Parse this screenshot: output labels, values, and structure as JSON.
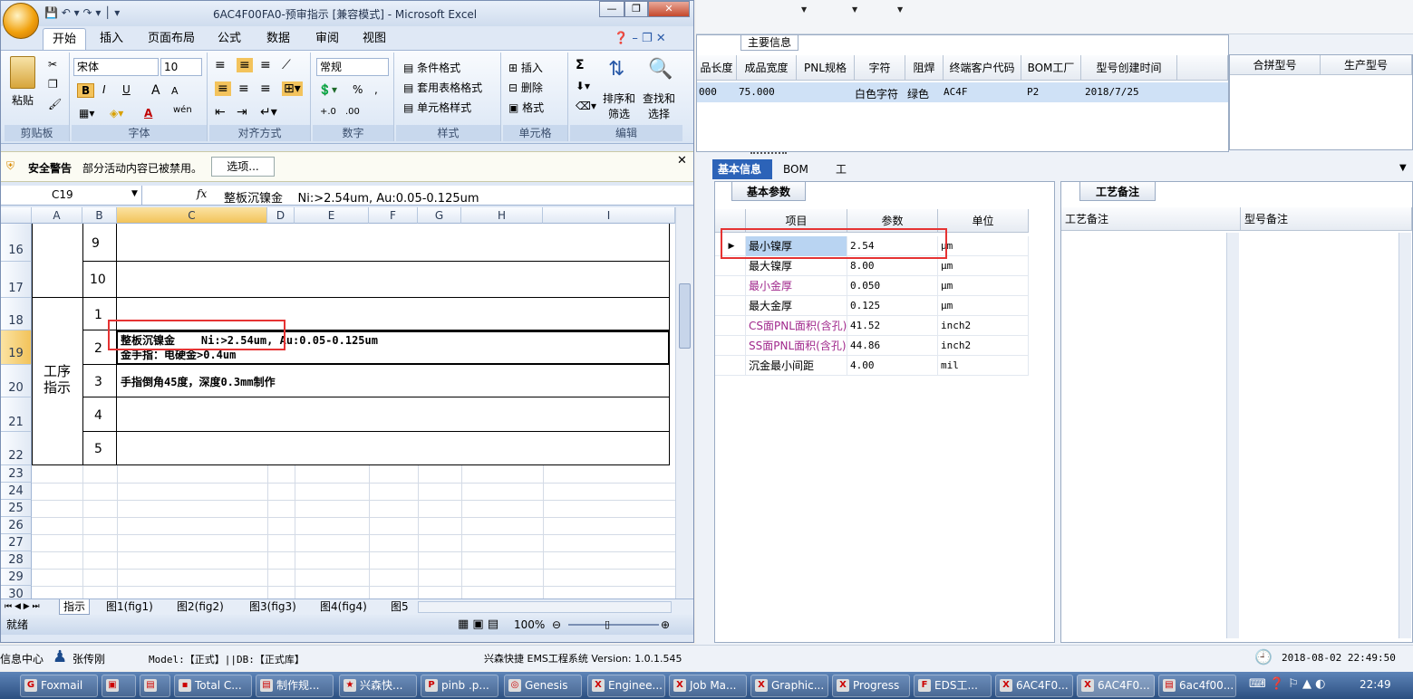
{
  "excel": {
    "title": "6AC4F00FA0-预审指示 [兼容模式] - Microsoft Excel",
    "tabs": [
      "开始",
      "插入",
      "页面布局",
      "公式",
      "数据",
      "审阅",
      "视图"
    ],
    "clipboard": {
      "paste": "粘贴",
      "label": "剪贴板"
    },
    "font": {
      "name": "宋体",
      "size": "10",
      "label": "字体",
      "bold": "B",
      "italic": "I",
      "underline": "U",
      "grow": "A",
      "shrink": "A",
      "fontcolor": "A",
      "phonetic": "wén"
    },
    "alignment": {
      "label": "对齐方式"
    },
    "number": {
      "format": "常规",
      "label": "数字",
      "percent": "%",
      "comma": ",",
      "inc": "+.0",
      "dec": ".00"
    },
    "styles": {
      "cond": "条件格式",
      "table": "套用表格格式",
      "cell": "单元格样式",
      "label": "样式"
    },
    "cells": {
      "insert": "插入",
      "delete": "删除",
      "format": "格式",
      "label": "单元格"
    },
    "editing": {
      "sum": "Σ",
      "sort": "排序和\n筛选",
      "find": "查找和\n选择",
      "label": "编辑"
    },
    "security": {
      "title": "安全警告",
      "msg": "部分活动内容已被禁用。",
      "options": "选项..."
    },
    "namebox": "C19",
    "fx": "fx",
    "formula": "整板沉镍金    Ni:>2.54um, Au:0.05-0.125um",
    "columns": [
      "A",
      "B",
      "C",
      "D",
      "E",
      "F",
      "G",
      "H",
      "I"
    ],
    "rows": [
      {
        "num": "16",
        "b": "9",
        "c": ""
      },
      {
        "num": "17",
        "b": "10",
        "c": ""
      },
      {
        "num": "18",
        "b": "1",
        "c": ""
      },
      {
        "num": "19",
        "b": "2",
        "c": "整板沉镍金    Ni:>2.54um, Au:0.05-0.125um",
        "c2": "金手指：电硬金>0.4um"
      },
      {
        "num": "20",
        "b": "3",
        "c": "手指倒角45度，深度0.3mm制作"
      },
      {
        "num": "21",
        "b": "4",
        "c": ""
      },
      {
        "num": "22",
        "b": "5",
        "c": ""
      }
    ],
    "merged_a": "工序\n指示",
    "empty_rows": [
      "23",
      "24",
      "25",
      "26",
      "27",
      "28",
      "29",
      "30"
    ],
    "sheet_tabs": [
      "指示",
      "图1(fig1)",
      "图2(fig2)",
      "图3(fig3)",
      "图4(fig4)",
      "图5"
    ],
    "status": "就绪",
    "zoom": "100%"
  },
  "ems": {
    "main_info_title": "主要信息",
    "headers": [
      "品长度",
      "成品宽度",
      "PNL规格",
      "字符",
      "阻焊",
      "终端客户代码",
      "BOM工厂",
      "型号创建时间"
    ],
    "row": [
      "000",
      "75.000",
      "",
      "白色字符",
      "绿色",
      "AC4F",
      "P2",
      "2018/7/25"
    ],
    "merge_headers": [
      "合拼型号",
      "生产型号"
    ],
    "tabs": [
      "基本信息",
      "BOM",
      "工时"
    ],
    "param_tab": "基本参数",
    "param_headers": [
      "项目",
      "参数",
      "单位"
    ],
    "params": [
      {
        "item": "最小镍厚",
        "value": "2.54",
        "unit": "μm",
        "color": "#000000"
      },
      {
        "item": "最大镍厚",
        "value": "8.00",
        "unit": "μm",
        "color": "#000000"
      },
      {
        "item": "最小金厚",
        "value": "0.050",
        "unit": "μm",
        "color": "#a0288c"
      },
      {
        "item": "最大金厚",
        "value": "0.125",
        "unit": "μm",
        "color": "#000000"
      },
      {
        "item": "CS面PNL面积(含孔)",
        "value": "41.52",
        "unit": "inch2",
        "color": "#a0288c"
      },
      {
        "item": "SS面PNL面积(含孔)",
        "value": "44.86",
        "unit": "inch2",
        "color": "#a0288c"
      },
      {
        "item": "沉金最小间距",
        "value": "4.00",
        "unit": "mil",
        "color": "#000000"
      }
    ],
    "craft_tab": "工艺备注",
    "craft_headers": [
      "工艺备注",
      "型号备注"
    ]
  },
  "status": {
    "left": "信息中心",
    "user": "张传刚",
    "model": "Model:【正式】||DB:【正式库】",
    "system": "兴森快捷 EMS工程系统 Version: 1.0.1.545",
    "datetime": "2018-08-02 22:49:50"
  },
  "taskbar": {
    "items": [
      "Foxmail",
      "",
      "",
      "Total C...",
      "制作规...",
      "兴森快...",
      "pinb .p...",
      "Genesis",
      "Enginee...",
      "Job Ma...",
      "Graphic...",
      "Progress",
      "EDS工...",
      "6AC4F0...",
      "6AC4F0...",
      "6ac4f00..."
    ],
    "clock": "22:49"
  },
  "colors": {
    "accent": "#2c63b8",
    "highlight": "#e53333",
    "selected_row": "#cfe1f6"
  }
}
